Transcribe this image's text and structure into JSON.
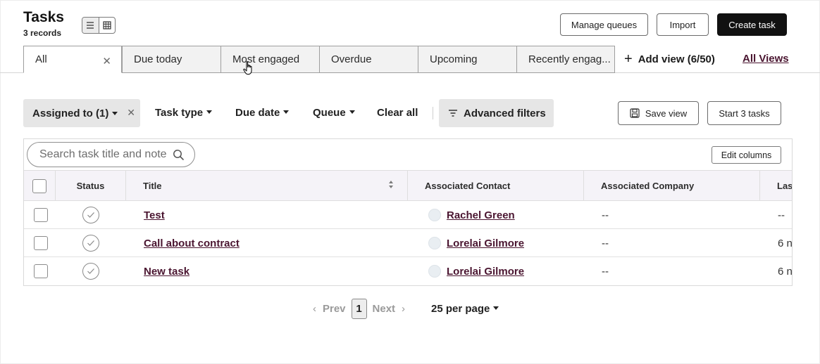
{
  "header": {
    "title": "Tasks",
    "records": "3 records",
    "buttons": {
      "manage_queues": "Manage queues",
      "import": "Import",
      "create_task": "Create task"
    }
  },
  "tabs": [
    {
      "label": "All",
      "active": true
    },
    {
      "label": "Due today"
    },
    {
      "label": "Most engaged"
    },
    {
      "label": "Overdue"
    },
    {
      "label": "Upcoming"
    },
    {
      "label": "Recently engag..."
    }
  ],
  "add_view": "Add view (6/50)",
  "all_views": "All Views",
  "filters": {
    "assigned": "Assigned to (1)",
    "task_type": "Task type",
    "due_date": "Due date",
    "queue": "Queue",
    "clear_all": "Clear all",
    "advanced": "Advanced filters",
    "save_view": "Save view",
    "start_tasks": "Start 3 tasks"
  },
  "table": {
    "search_placeholder": "Search task title and notes",
    "edit_columns": "Edit columns",
    "columns": [
      "Status",
      "Title",
      "Associated Contact",
      "Associated Company",
      "Las"
    ],
    "rows": [
      {
        "title": "Test",
        "contact": "Rachel Green",
        "company": "--",
        "last": "--"
      },
      {
        "title": "Call about contract",
        "contact": "Lorelai Gilmore",
        "company": "--",
        "last": "6 n"
      },
      {
        "title": "New task",
        "contact": "Lorelai Gilmore",
        "company": "--",
        "last": "6 n"
      }
    ]
  },
  "pagination": {
    "prev": "Prev",
    "page": "1",
    "next": "Next",
    "per_page": "25 per page"
  },
  "colors": {
    "accent_link": "#4a1530",
    "primary_button": "#111111",
    "header_bg": "#f5f3f8"
  }
}
